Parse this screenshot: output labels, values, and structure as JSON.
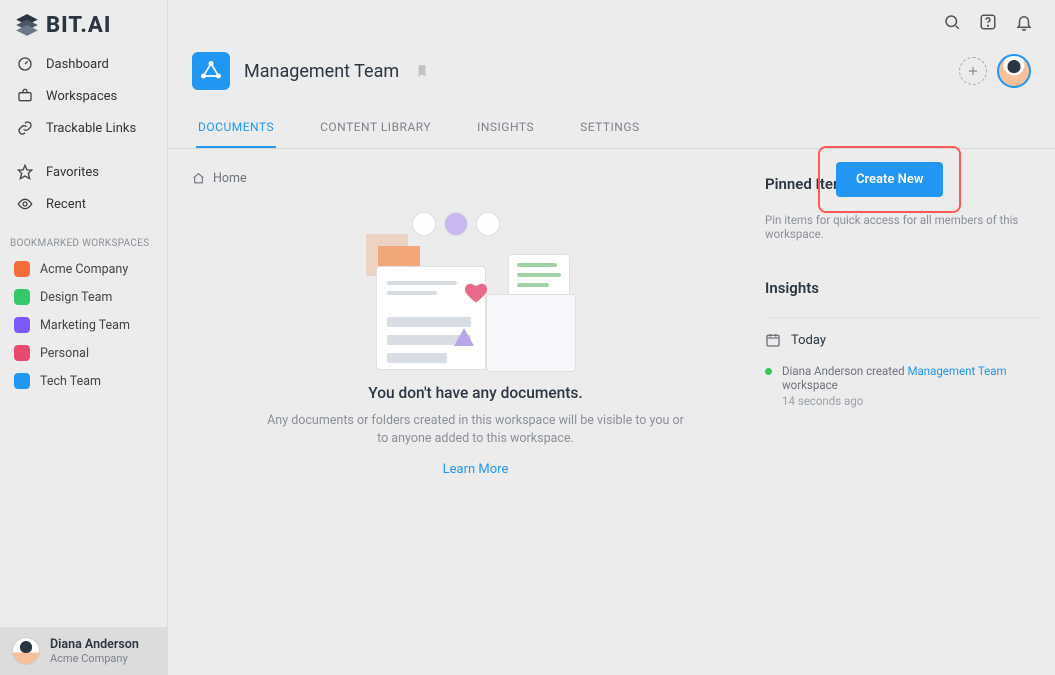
{
  "app": {
    "name": "BIT.AI"
  },
  "sidebar": {
    "nav": [
      {
        "label": "Dashboard"
      },
      {
        "label": "Workspaces"
      },
      {
        "label": "Trackable Links"
      },
      {
        "label": "Favorites"
      },
      {
        "label": "Recent"
      }
    ],
    "section_label": "BOOKMARKED WORKSPACES",
    "workspaces": [
      {
        "label": "Acme Company",
        "color": "#f36d3a"
      },
      {
        "label": "Design Team",
        "color": "#37c76b"
      },
      {
        "label": "Marketing Team",
        "color": "#7e57ff"
      },
      {
        "label": "Personal",
        "color": "#e84a6f"
      },
      {
        "label": "Tech Team",
        "color": "#2196F3"
      }
    ]
  },
  "user": {
    "name": "Diana Anderson",
    "org": "Acme Company"
  },
  "workspace": {
    "title": "Management Team"
  },
  "tabs": [
    {
      "label": "DOCUMENTS",
      "active": true
    },
    {
      "label": "CONTENT LIBRARY"
    },
    {
      "label": "INSIGHTS"
    },
    {
      "label": "SETTINGS"
    }
  ],
  "breadcrumb": {
    "home": "Home"
  },
  "create_button": "Create New",
  "empty": {
    "title": "You don't have any documents.",
    "body": "Any documents or folders created in this workspace will be visible to you or to anyone added to this workspace.",
    "learn": "Learn More"
  },
  "right": {
    "pinned_title": "Pinned Items",
    "pinned_sub": "Pin items for quick access for all members of this workspace.",
    "insights_title": "Insights",
    "today_label": "Today",
    "activity_prefix": "Diana Anderson created ",
    "activity_link": "Management Team",
    "activity_suffix": " workspace",
    "activity_time": "14 seconds ago"
  }
}
